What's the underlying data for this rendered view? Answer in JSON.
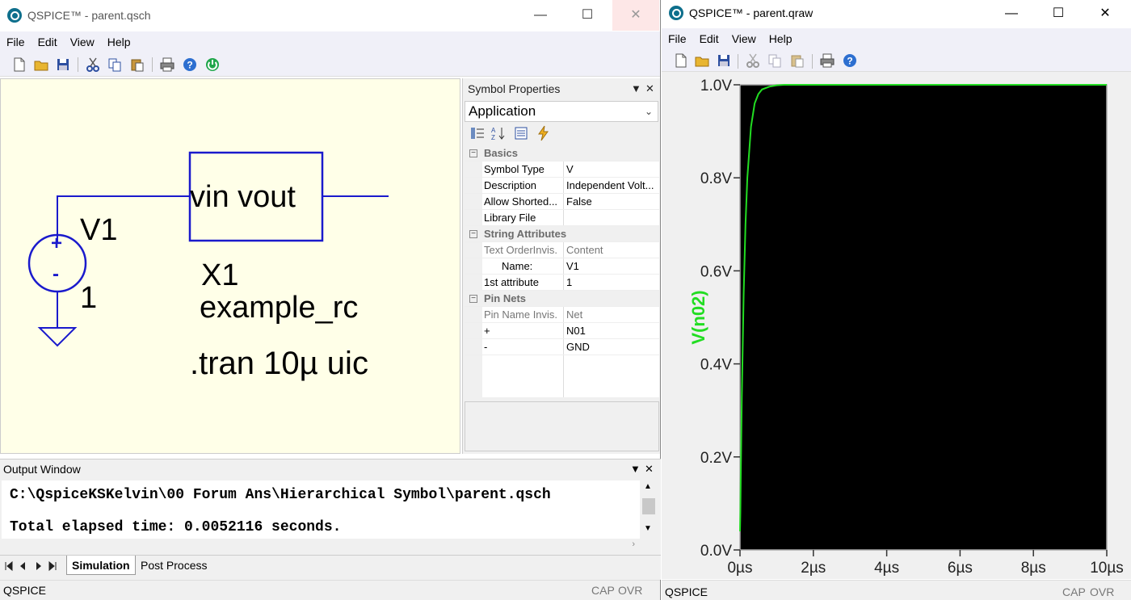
{
  "schematic_window": {
    "title": "QSPICE™ - parent.qsch",
    "menu": [
      "File",
      "Edit",
      "View",
      "Help"
    ],
    "canvas": {
      "source_name": "V1",
      "source_value": "1",
      "subckt_pins": "vin  vout",
      "subckt_name": "X1",
      "subckt_model": "example_rc",
      "directive": ".tran 10µ uic",
      "plus_sign": "+",
      "minus_sign": "-"
    },
    "symbol_properties": {
      "title": "Symbol Properties",
      "selector": "Application",
      "categories": [
        {
          "name": "Basics",
          "rows": [
            {
              "key": "Symbol Type",
              "value": "V"
            },
            {
              "key": "Description",
              "value": "Independent Volt..."
            },
            {
              "key": "Allow Shorted...",
              "value": "False"
            },
            {
              "key": "Library File",
              "value": ""
            }
          ]
        },
        {
          "name": "String Attributes",
          "rows": [
            {
              "key": "Text OrderInvis.",
              "value": "Content",
              "sub": true
            },
            {
              "key": "Name:",
              "value": "V1",
              "indent": true
            },
            {
              "key": "1st attribute",
              "value": "1"
            }
          ]
        },
        {
          "name": "Pin Nets",
          "rows": [
            {
              "key": "Pin Name  Invis.",
              "value": "Net",
              "sub": true
            },
            {
              "key": "+",
              "value": "N01"
            },
            {
              "key": "-",
              "value": "GND"
            }
          ]
        }
      ]
    },
    "output_window": {
      "title": "Output Window",
      "lines": [
        "C:\\QspiceKSKelvin\\00 Forum Ans\\Hierarchical Symbol\\parent.qsch",
        "Total elapsed time: 0.0052116 seconds."
      ],
      "tabs": [
        "Simulation",
        "Post Process"
      ]
    },
    "status": {
      "text": "QSPICE",
      "cap": "CAP",
      "ovr": "OVR"
    }
  },
  "waveform_window": {
    "title": "QSPICE™ - parent.qraw",
    "menu": [
      "File",
      "Edit",
      "View",
      "Help"
    ],
    "status": {
      "text": "QSPICE",
      "cap": "CAP",
      "ovr": "OVR"
    }
  },
  "colors": {
    "trace": "#22dd22",
    "plot_bg": "#000000",
    "wire": "#1a1acc",
    "schematic_bg": "#ffffe8"
  },
  "chart_data": {
    "type": "line",
    "title": "",
    "xlabel": "",
    "ylabel": "V(n02)",
    "xlim": [
      0,
      10
    ],
    "ylim": [
      0,
      1
    ],
    "xticks": [
      "0µs",
      "2µs",
      "4µs",
      "6µs",
      "8µs",
      "10µs"
    ],
    "yticks": [
      "0.0V",
      "0.2V",
      "0.4V",
      "0.6V",
      "0.8V",
      "1.0V"
    ],
    "grid": false,
    "series": [
      {
        "name": "V(n02)",
        "x": [
          0,
          0.01,
          0.02,
          0.05,
          0.1,
          0.15,
          0.2,
          0.3,
          0.4,
          0.5,
          0.6,
          0.8,
          1.0,
          1.2,
          1.5,
          2.0,
          3.0,
          4.0,
          6.0,
          8.0,
          10.0
        ],
        "y": [
          0.04,
          0.08,
          0.15,
          0.33,
          0.55,
          0.7,
          0.8,
          0.91,
          0.96,
          0.98,
          0.99,
          0.996,
          0.999,
          1.0,
          1.0,
          1.0,
          1.0,
          1.0,
          1.0,
          1.0,
          1.0
        ]
      }
    ]
  }
}
